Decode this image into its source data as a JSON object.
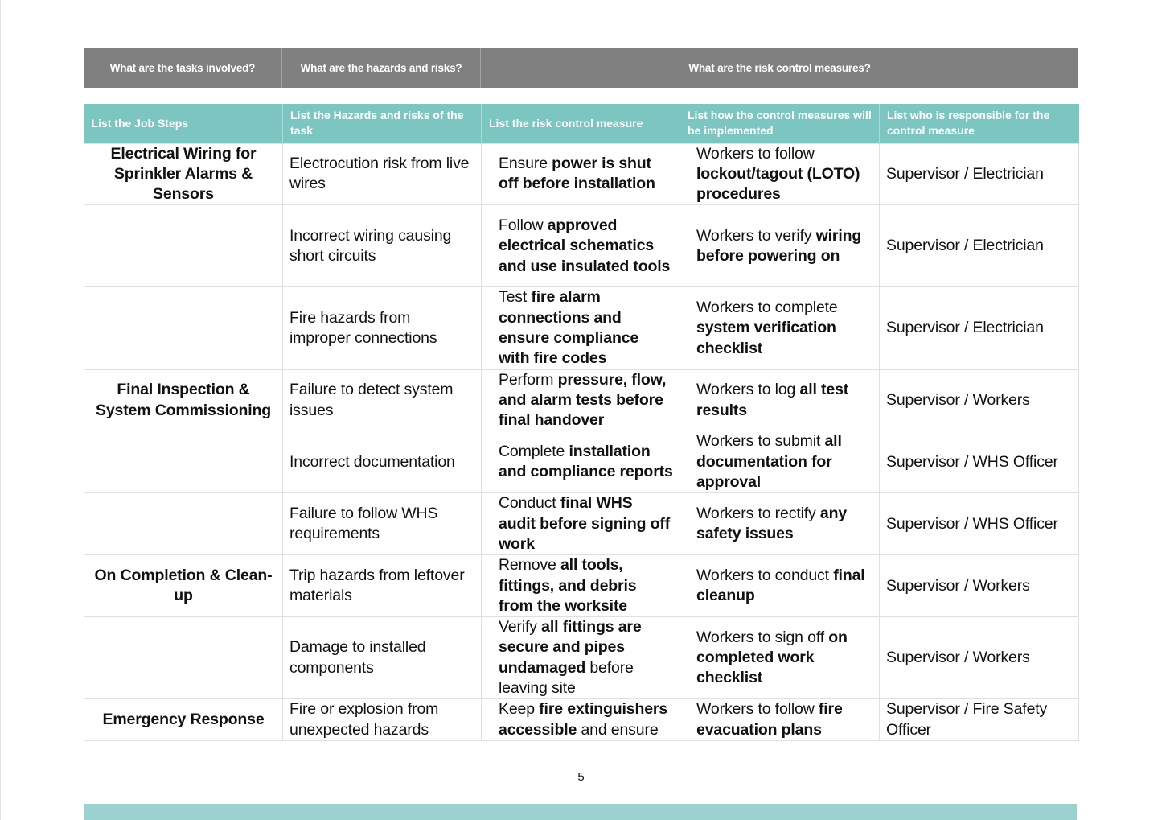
{
  "colors": {
    "top_header_bg": "#808080",
    "column_header_bg": "#7cc5c1",
    "footer_bar": "#9bd1cf",
    "cell_border": "#e0e0e0"
  },
  "top_header": [
    "What are the tasks involved?",
    "What are the hazards and risks?",
    "What are the risk control measures?"
  ],
  "columns": [
    "List the Job Steps",
    "List the Hazards and risks of the task",
    "List the risk control measure",
    "List how the control measures will be implemented",
    "List who is responsible for the control measure"
  ],
  "rows": [
    {
      "step": "Electrical Wiring for Sprinkler Alarms & Sensors",
      "hazard": "Electrocution risk from live wires",
      "control": [
        {
          "t": "Ensure ",
          "b": false
        },
        {
          "t": "power is shut off before installation",
          "b": true
        }
      ],
      "implementation": [
        {
          "t": "Workers to follow ",
          "b": false
        },
        {
          "t": "lockout/tagout (LOTO) procedures",
          "b": true
        }
      ],
      "responsible": "Supervisor / Electrician"
    },
    {
      "step": "",
      "hazard": "Incorrect wiring causing short circuits",
      "control": [
        {
          "t": "Follow ",
          "b": false
        },
        {
          "t": "approved electrical schematics and use insulated tools",
          "b": true
        }
      ],
      "implementation": [
        {
          "t": "Workers to verify ",
          "b": false
        },
        {
          "t": "wiring before powering on",
          "b": true
        }
      ],
      "responsible": "Supervisor / Electrician"
    },
    {
      "step": "",
      "hazard": "Fire hazards from improper connections",
      "control": [
        {
          "t": "Test ",
          "b": false
        },
        {
          "t": "fire alarm connections and ensure compliance with fire codes",
          "b": true
        }
      ],
      "implementation": [
        {
          "t": "Workers to complete ",
          "b": false
        },
        {
          "t": "system verification checklist",
          "b": true
        }
      ],
      "responsible": "Supervisor / Electrician"
    },
    {
      "step": "Final Inspection & System Commissioning",
      "hazard": "Failure to detect system issues",
      "control": [
        {
          "t": "Perform ",
          "b": false
        },
        {
          "t": "pressure, flow, and alarm tests before final handover",
          "b": true
        }
      ],
      "implementation": [
        {
          "t": "Workers to log ",
          "b": false
        },
        {
          "t": "all test results",
          "b": true
        }
      ],
      "responsible": "Supervisor / Workers"
    },
    {
      "step": "",
      "hazard": "Incorrect documentation",
      "control": [
        {
          "t": "Complete ",
          "b": false
        },
        {
          "t": "installation and compliance reports",
          "b": true
        }
      ],
      "implementation": [
        {
          "t": "Workers to submit ",
          "b": false
        },
        {
          "t": "all documentation for approval",
          "b": true
        }
      ],
      "responsible": "Supervisor / WHS Officer"
    },
    {
      "step": "",
      "hazard": "Failure to follow WHS requirements",
      "control": [
        {
          "t": "Conduct ",
          "b": false
        },
        {
          "t": "final WHS audit before signing off work",
          "b": true
        }
      ],
      "implementation": [
        {
          "t": "Workers to rectify ",
          "b": false
        },
        {
          "t": "any safety issues",
          "b": true
        }
      ],
      "responsible": "Supervisor / WHS Officer"
    },
    {
      "step": "On Completion & Clean-up",
      "hazard": "Trip hazards from leftover materials",
      "control": [
        {
          "t": "Remove ",
          "b": false
        },
        {
          "t": "all tools, fittings, and debris from the worksite",
          "b": true
        }
      ],
      "implementation": [
        {
          "t": "Workers to conduct ",
          "b": false
        },
        {
          "t": "final cleanup",
          "b": true
        }
      ],
      "responsible": "Supervisor / Workers"
    },
    {
      "step": "",
      "hazard": "Damage to installed components",
      "control": [
        {
          "t": "Verify ",
          "b": false
        },
        {
          "t": "all fittings are secure and pipes undamaged",
          "b": true
        },
        {
          "t": " before leaving site",
          "b": false
        }
      ],
      "implementation": [
        {
          "t": "Workers to sign off ",
          "b": false
        },
        {
          "t": "on completed work checklist",
          "b": true
        }
      ],
      "responsible": "Supervisor / Workers"
    },
    {
      "step": "Emergency Response",
      "hazard": "Fire or explosion from unexpected hazards",
      "control": [
        {
          "t": "Keep ",
          "b": false
        },
        {
          "t": "fire extinguishers accessible",
          "b": true
        },
        {
          "t": " and ensure",
          "b": false
        }
      ],
      "implementation": [
        {
          "t": "Workers to follow ",
          "b": false
        },
        {
          "t": "fire evacuation plans",
          "b": true
        }
      ],
      "responsible": "Supervisor / Fire Safety Officer"
    }
  ],
  "page_number": "5"
}
